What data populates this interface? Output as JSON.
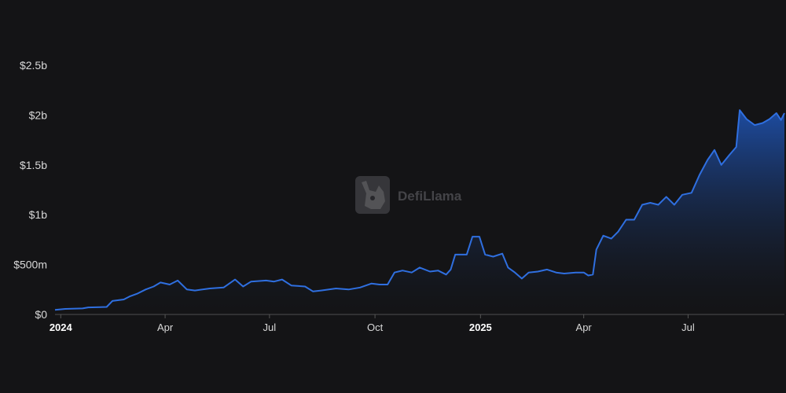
{
  "watermark": {
    "text": "DefiLlama",
    "icon": "llama-logo-icon"
  },
  "colors": {
    "background": "#141416",
    "line": "#2f6fe0",
    "area_top": "#1e4fa8",
    "area_bottom": "#141416",
    "axis": "#555555"
  },
  "chart_data": {
    "type": "area",
    "title": "",
    "xlabel": "",
    "ylabel": "",
    "ylim": [
      0,
      2500000000
    ],
    "xlim": [
      "2023-12-27",
      "2025-09-23"
    ],
    "grid": false,
    "y_ticks": [
      {
        "value": 0,
        "label": "$0"
      },
      {
        "value": 500000000,
        "label": "$500m"
      },
      {
        "value": 1000000000,
        "label": "$1b"
      },
      {
        "value": 1500000000,
        "label": "$1.5b"
      },
      {
        "value": 2000000000,
        "label": "$2b"
      },
      {
        "value": 2500000000,
        "label": "$2.5b"
      }
    ],
    "x_ticks": [
      {
        "date": "2024-01-01",
        "label": "2024",
        "bold": true
      },
      {
        "date": "2024-04-01",
        "label": "Apr",
        "bold": false
      },
      {
        "date": "2024-07-01",
        "label": "Jul",
        "bold": false
      },
      {
        "date": "2024-10-01",
        "label": "Oct",
        "bold": false
      },
      {
        "date": "2025-01-01",
        "label": "2025",
        "bold": true
      },
      {
        "date": "2025-04-01",
        "label": "Apr",
        "bold": false
      },
      {
        "date": "2025-07-01",
        "label": "Jul",
        "bold": false
      }
    ],
    "series": [
      {
        "points": [
          [
            "2023-12-27",
            45000000
          ],
          [
            "2024-01-05",
            55000000
          ],
          [
            "2024-01-20",
            60000000
          ],
          [
            "2024-01-25",
            70000000
          ],
          [
            "2024-02-10",
            75000000
          ],
          [
            "2024-02-15",
            135000000
          ],
          [
            "2024-02-25",
            150000000
          ],
          [
            "2024-03-01",
            180000000
          ],
          [
            "2024-03-08",
            210000000
          ],
          [
            "2024-03-15",
            250000000
          ],
          [
            "2024-03-22",
            280000000
          ],
          [
            "2024-03-28",
            320000000
          ],
          [
            "2024-04-05",
            300000000
          ],
          [
            "2024-04-12",
            340000000
          ],
          [
            "2024-04-20",
            250000000
          ],
          [
            "2024-04-27",
            240000000
          ],
          [
            "2024-05-10",
            260000000
          ],
          [
            "2024-05-22",
            270000000
          ],
          [
            "2024-06-01",
            350000000
          ],
          [
            "2024-06-08",
            280000000
          ],
          [
            "2024-06-15",
            330000000
          ],
          [
            "2024-06-28",
            340000000
          ],
          [
            "2024-07-05",
            330000000
          ],
          [
            "2024-07-12",
            350000000
          ],
          [
            "2024-07-20",
            290000000
          ],
          [
            "2024-08-01",
            280000000
          ],
          [
            "2024-08-08",
            230000000
          ],
          [
            "2024-08-15",
            240000000
          ],
          [
            "2024-08-28",
            260000000
          ],
          [
            "2024-09-08",
            250000000
          ],
          [
            "2024-09-18",
            270000000
          ],
          [
            "2024-09-28",
            310000000
          ],
          [
            "2024-10-05",
            300000000
          ],
          [
            "2024-10-12",
            300000000
          ],
          [
            "2024-10-18",
            420000000
          ],
          [
            "2024-10-25",
            440000000
          ],
          [
            "2024-11-02",
            420000000
          ],
          [
            "2024-11-09",
            470000000
          ],
          [
            "2024-11-18",
            430000000
          ],
          [
            "2024-11-25",
            440000000
          ],
          [
            "2024-12-02",
            400000000
          ],
          [
            "2024-12-06",
            450000000
          ],
          [
            "2024-12-10",
            600000000
          ],
          [
            "2024-12-20",
            600000000
          ],
          [
            "2024-12-25",
            780000000
          ],
          [
            "2024-12-31",
            780000000
          ],
          [
            "2025-01-05",
            600000000
          ],
          [
            "2025-01-12",
            580000000
          ],
          [
            "2025-01-20",
            610000000
          ],
          [
            "2025-01-25",
            470000000
          ],
          [
            "2025-01-31",
            420000000
          ],
          [
            "2025-02-06",
            360000000
          ],
          [
            "2025-02-12",
            420000000
          ],
          [
            "2025-02-20",
            430000000
          ],
          [
            "2025-02-28",
            450000000
          ],
          [
            "2025-03-08",
            420000000
          ],
          [
            "2025-03-15",
            410000000
          ],
          [
            "2025-03-25",
            420000000
          ],
          [
            "2025-04-01",
            420000000
          ],
          [
            "2025-04-05",
            390000000
          ],
          [
            "2025-04-09",
            400000000
          ],
          [
            "2025-04-12",
            650000000
          ],
          [
            "2025-04-18",
            790000000
          ],
          [
            "2025-04-25",
            760000000
          ],
          [
            "2025-05-01",
            830000000
          ],
          [
            "2025-05-08",
            950000000
          ],
          [
            "2025-05-15",
            950000000
          ],
          [
            "2025-05-22",
            1100000000
          ],
          [
            "2025-05-29",
            1120000000
          ],
          [
            "2025-06-05",
            1100000000
          ],
          [
            "2025-06-12",
            1180000000
          ],
          [
            "2025-06-19",
            1100000000
          ],
          [
            "2025-06-26",
            1200000000
          ],
          [
            "2025-07-04",
            1220000000
          ],
          [
            "2025-07-11",
            1400000000
          ],
          [
            "2025-07-18",
            1550000000
          ],
          [
            "2025-07-24",
            1650000000
          ],
          [
            "2025-07-30",
            1500000000
          ],
          [
            "2025-08-06",
            1600000000
          ],
          [
            "2025-08-12",
            1680000000
          ],
          [
            "2025-08-15",
            2050000000
          ],
          [
            "2025-08-21",
            1960000000
          ],
          [
            "2025-08-28",
            1900000000
          ],
          [
            "2025-09-04",
            1920000000
          ],
          [
            "2025-09-10",
            1960000000
          ],
          [
            "2025-09-16",
            2020000000
          ],
          [
            "2025-09-20",
            1950000000
          ],
          [
            "2025-09-23",
            2020000000
          ]
        ]
      }
    ]
  }
}
